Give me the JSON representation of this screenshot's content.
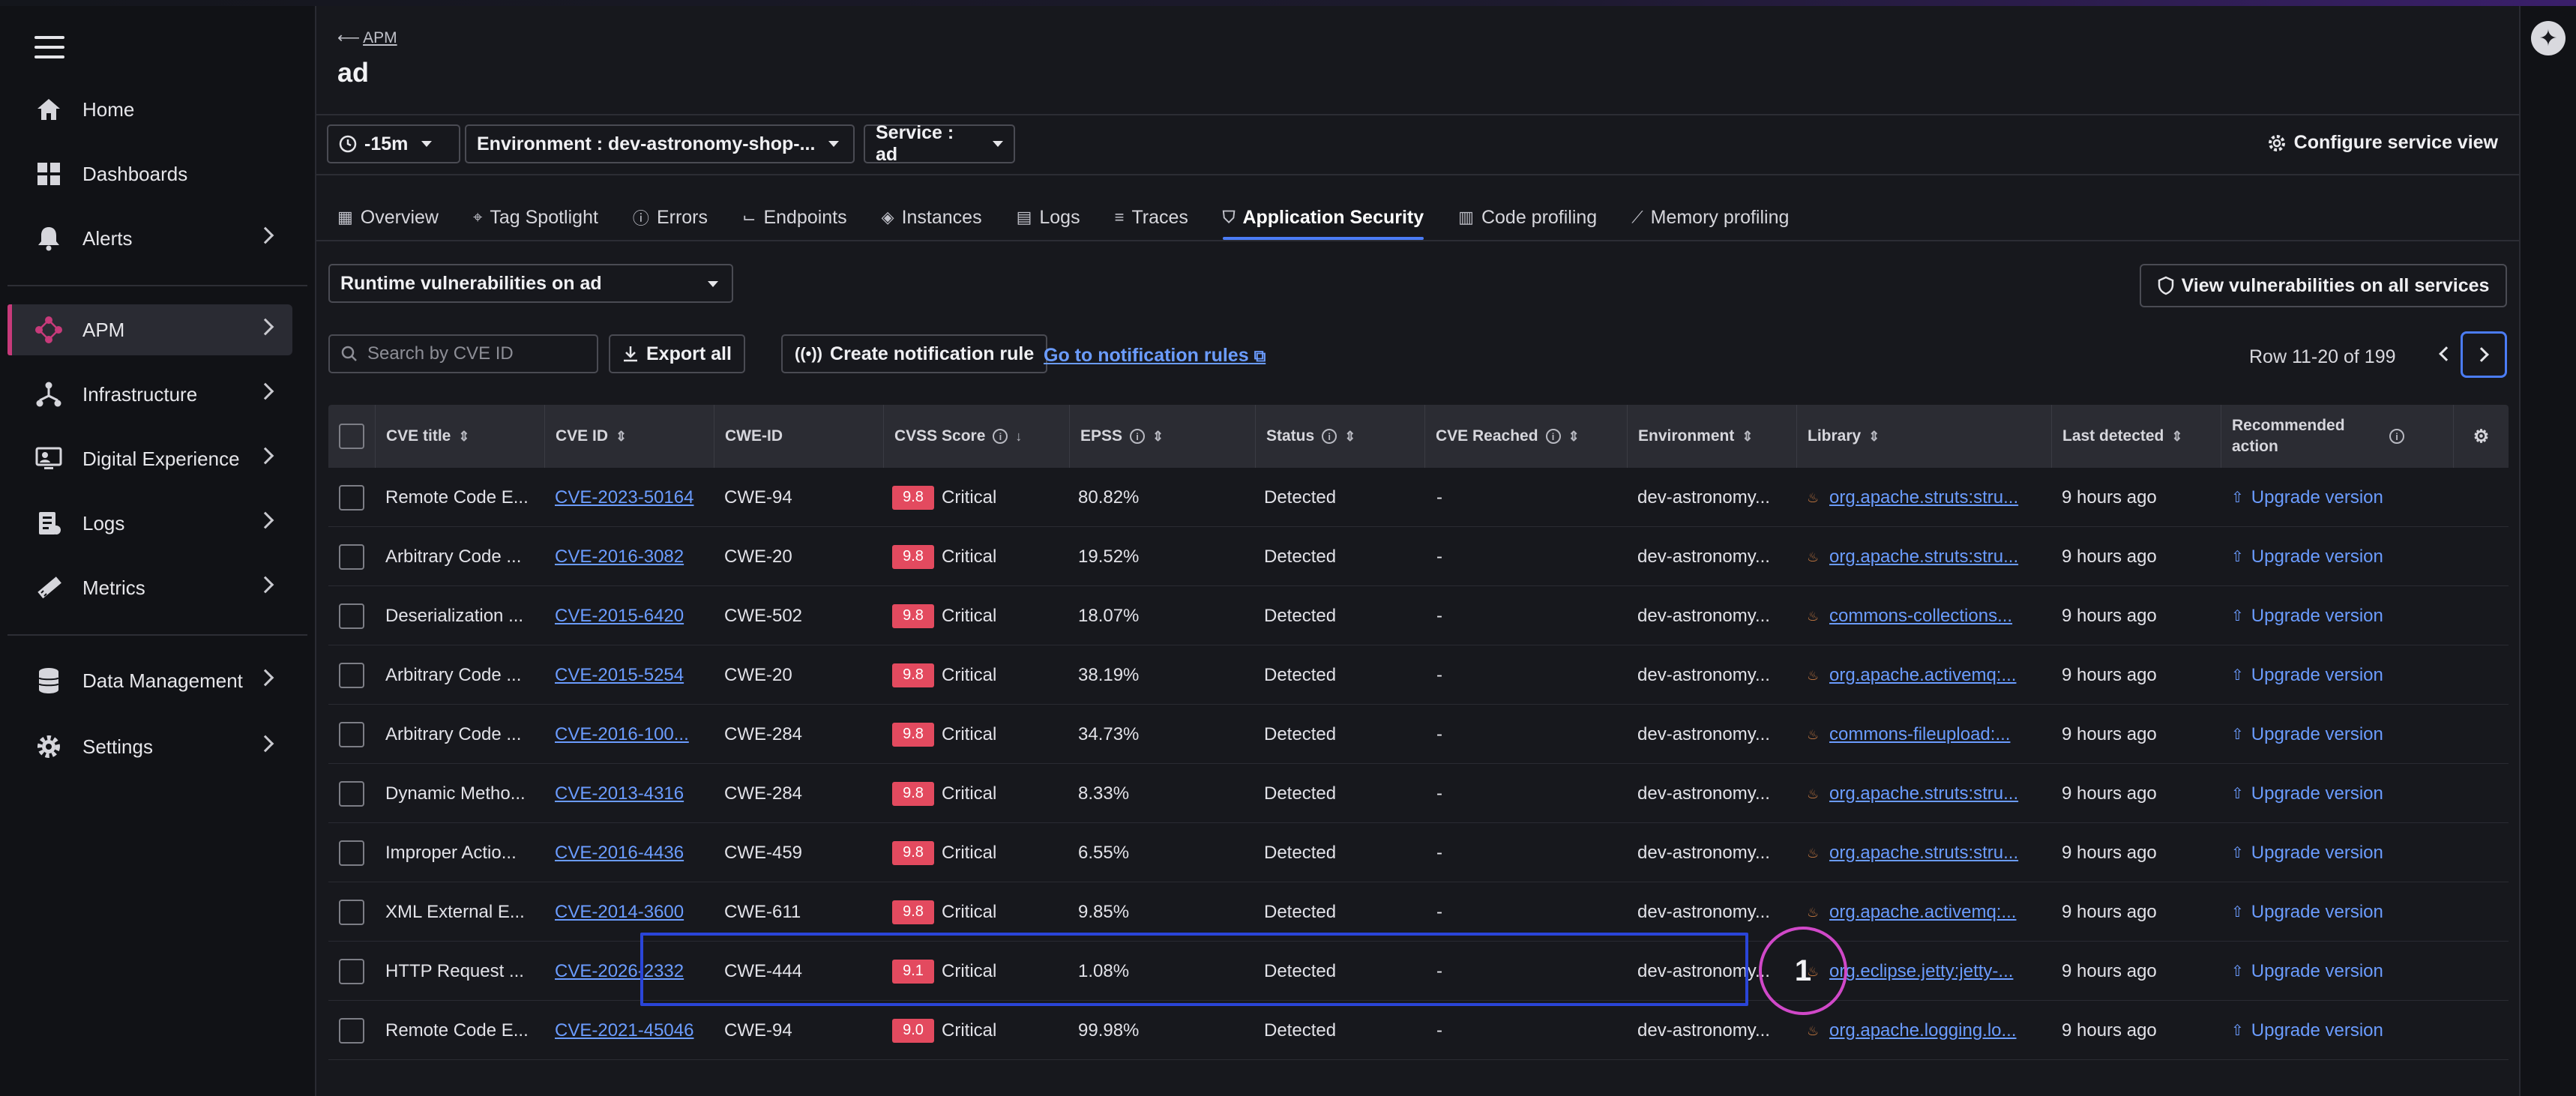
{
  "sidebar": {
    "items": [
      {
        "label": "Home",
        "icon": "home-icon",
        "chevron": false
      },
      {
        "label": "Dashboards",
        "icon": "dashboards-icon",
        "chevron": false
      },
      {
        "label": "Alerts",
        "icon": "bell-icon",
        "chevron": true
      },
      {
        "label": "APM",
        "icon": "apm-icon",
        "chevron": true,
        "active": true
      },
      {
        "label": "Infrastructure",
        "icon": "infrastructure-icon",
        "chevron": true
      },
      {
        "label": "Digital Experience",
        "icon": "digital-experience-icon",
        "chevron": true
      },
      {
        "label": "Logs",
        "icon": "logs-icon",
        "chevron": true
      },
      {
        "label": "Metrics",
        "icon": "metrics-icon",
        "chevron": true
      },
      {
        "label": "Data Management",
        "icon": "database-icon",
        "chevron": true
      },
      {
        "label": "Settings",
        "icon": "gear-icon",
        "chevron": true
      }
    ]
  },
  "header": {
    "breadcrumb": "APM",
    "title": "ad",
    "time_filter": "-15m",
    "environment_filter": "Environment : dev-astronomy-shop-...",
    "service_filter": "Service : ad",
    "configure_label": "Configure service view"
  },
  "tabs": [
    {
      "label": "Overview",
      "icon": "▦"
    },
    {
      "label": "Tag Spotlight",
      "icon": "⌖"
    },
    {
      "label": "Errors",
      "icon": "ⓘ"
    },
    {
      "label": "Endpoints",
      "icon": "⌙"
    },
    {
      "label": "Instances",
      "icon": "◈"
    },
    {
      "label": "Logs",
      "icon": "▤"
    },
    {
      "label": "Traces",
      "icon": "≡"
    },
    {
      "label": "Application Security",
      "icon": "⛉",
      "active": true
    },
    {
      "label": "Code profiling",
      "icon": "▥"
    },
    {
      "label": "Memory profiling",
      "icon": "⟋"
    }
  ],
  "toolbar": {
    "runtime_select": "Runtime vulnerabilities on ad",
    "view_all_label": "View vulnerabilities on all services",
    "search_placeholder": "Search by CVE ID",
    "export_label": "Export all",
    "create_rule_label": "Create notification rule",
    "notification_link": "Go to notification rules",
    "row_info": "Row 11-20 of 199"
  },
  "table": {
    "columns": [
      "CVE title",
      "CVE ID",
      "CWE-ID",
      "CVSS Score",
      "EPSS",
      "Status",
      "CVE Reached",
      "Environment",
      "Library",
      "Last detected",
      "Recommended action"
    ],
    "rows": [
      {
        "title": "Remote Code E...",
        "cve": "CVE-2023-50164",
        "cwe": "CWE-94",
        "score": "9.8",
        "severity": "Critical",
        "epss": "80.82%",
        "status": "Detected",
        "reached": "-",
        "env": "dev-astronomy...",
        "library": "org.apache.struts:stru...",
        "last": "9 hours ago",
        "action": "Upgrade version"
      },
      {
        "title": "Arbitrary Code ...",
        "cve": "CVE-2016-3082",
        "cwe": "CWE-20",
        "score": "9.8",
        "severity": "Critical",
        "epss": "19.52%",
        "status": "Detected",
        "reached": "-",
        "env": "dev-astronomy...",
        "library": "org.apache.struts:stru...",
        "last": "9 hours ago",
        "action": "Upgrade version"
      },
      {
        "title": "Deserialization ...",
        "cve": "CVE-2015-6420",
        "cwe": "CWE-502",
        "score": "9.8",
        "severity": "Critical",
        "epss": "18.07%",
        "status": "Detected",
        "reached": "-",
        "env": "dev-astronomy...",
        "library": "commons-collections...",
        "last": "9 hours ago",
        "action": "Upgrade version"
      },
      {
        "title": "Arbitrary Code ...",
        "cve": "CVE-2015-5254",
        "cwe": "CWE-20",
        "score": "9.8",
        "severity": "Critical",
        "epss": "38.19%",
        "status": "Detected",
        "reached": "-",
        "env": "dev-astronomy...",
        "library": "org.apache.activemq:...",
        "last": "9 hours ago",
        "action": "Upgrade version"
      },
      {
        "title": "Arbitrary Code ...",
        "cve": "CVE-2016-100...",
        "cwe": "CWE-284",
        "score": "9.8",
        "severity": "Critical",
        "epss": "34.73%",
        "status": "Detected",
        "reached": "-",
        "env": "dev-astronomy...",
        "library": "commons-fileupload:...",
        "last": "9 hours ago",
        "action": "Upgrade version"
      },
      {
        "title": "Dynamic Metho...",
        "cve": "CVE-2013-4316",
        "cwe": "CWE-284",
        "score": "9.8",
        "severity": "Critical",
        "epss": "8.33%",
        "status": "Detected",
        "reached": "-",
        "env": "dev-astronomy...",
        "library": "org.apache.struts:stru...",
        "last": "9 hours ago",
        "action": "Upgrade version"
      },
      {
        "title": "Improper Actio...",
        "cve": "CVE-2016-4436",
        "cwe": "CWE-459",
        "score": "9.8",
        "severity": "Critical",
        "epss": "6.55%",
        "status": "Detected",
        "reached": "-",
        "env": "dev-astronomy...",
        "library": "org.apache.struts:stru...",
        "last": "9 hours ago",
        "action": "Upgrade version"
      },
      {
        "title": "XML External E...",
        "cve": "CVE-2014-3600",
        "cwe": "CWE-611",
        "score": "9.8",
        "severity": "Critical",
        "epss": "9.85%",
        "status": "Detected",
        "reached": "-",
        "env": "dev-astronomy...",
        "library": "org.apache.activemq:...",
        "last": "9 hours ago",
        "action": "Upgrade version"
      },
      {
        "title": "HTTP Request ...",
        "cve": "CVE-2026-2332",
        "cwe": "CWE-444",
        "score": "9.1",
        "severity": "Critical",
        "epss": "1.08%",
        "status": "Detected",
        "reached": "-",
        "env": "dev-astronomy...",
        "library": "org.eclipse.jetty:jetty-...",
        "last": "9 hours ago",
        "action": "Upgrade version"
      },
      {
        "title": "Remote Code E...",
        "cve": "CVE-2021-45046",
        "cwe": "CWE-94",
        "score": "9.0",
        "severity": "Critical",
        "epss": "99.98%",
        "status": "Detected",
        "reached": "-",
        "env": "dev-astronomy...",
        "library": "org.apache.logging.lo...",
        "last": "9 hours ago",
        "action": "Upgrade version"
      }
    ]
  },
  "annotation": {
    "label": "1"
  },
  "colors": {
    "accent": "#4b7cf5",
    "critical": "#e34a5f",
    "link": "#6b9cff",
    "apm_marker": "#c73a7a"
  }
}
